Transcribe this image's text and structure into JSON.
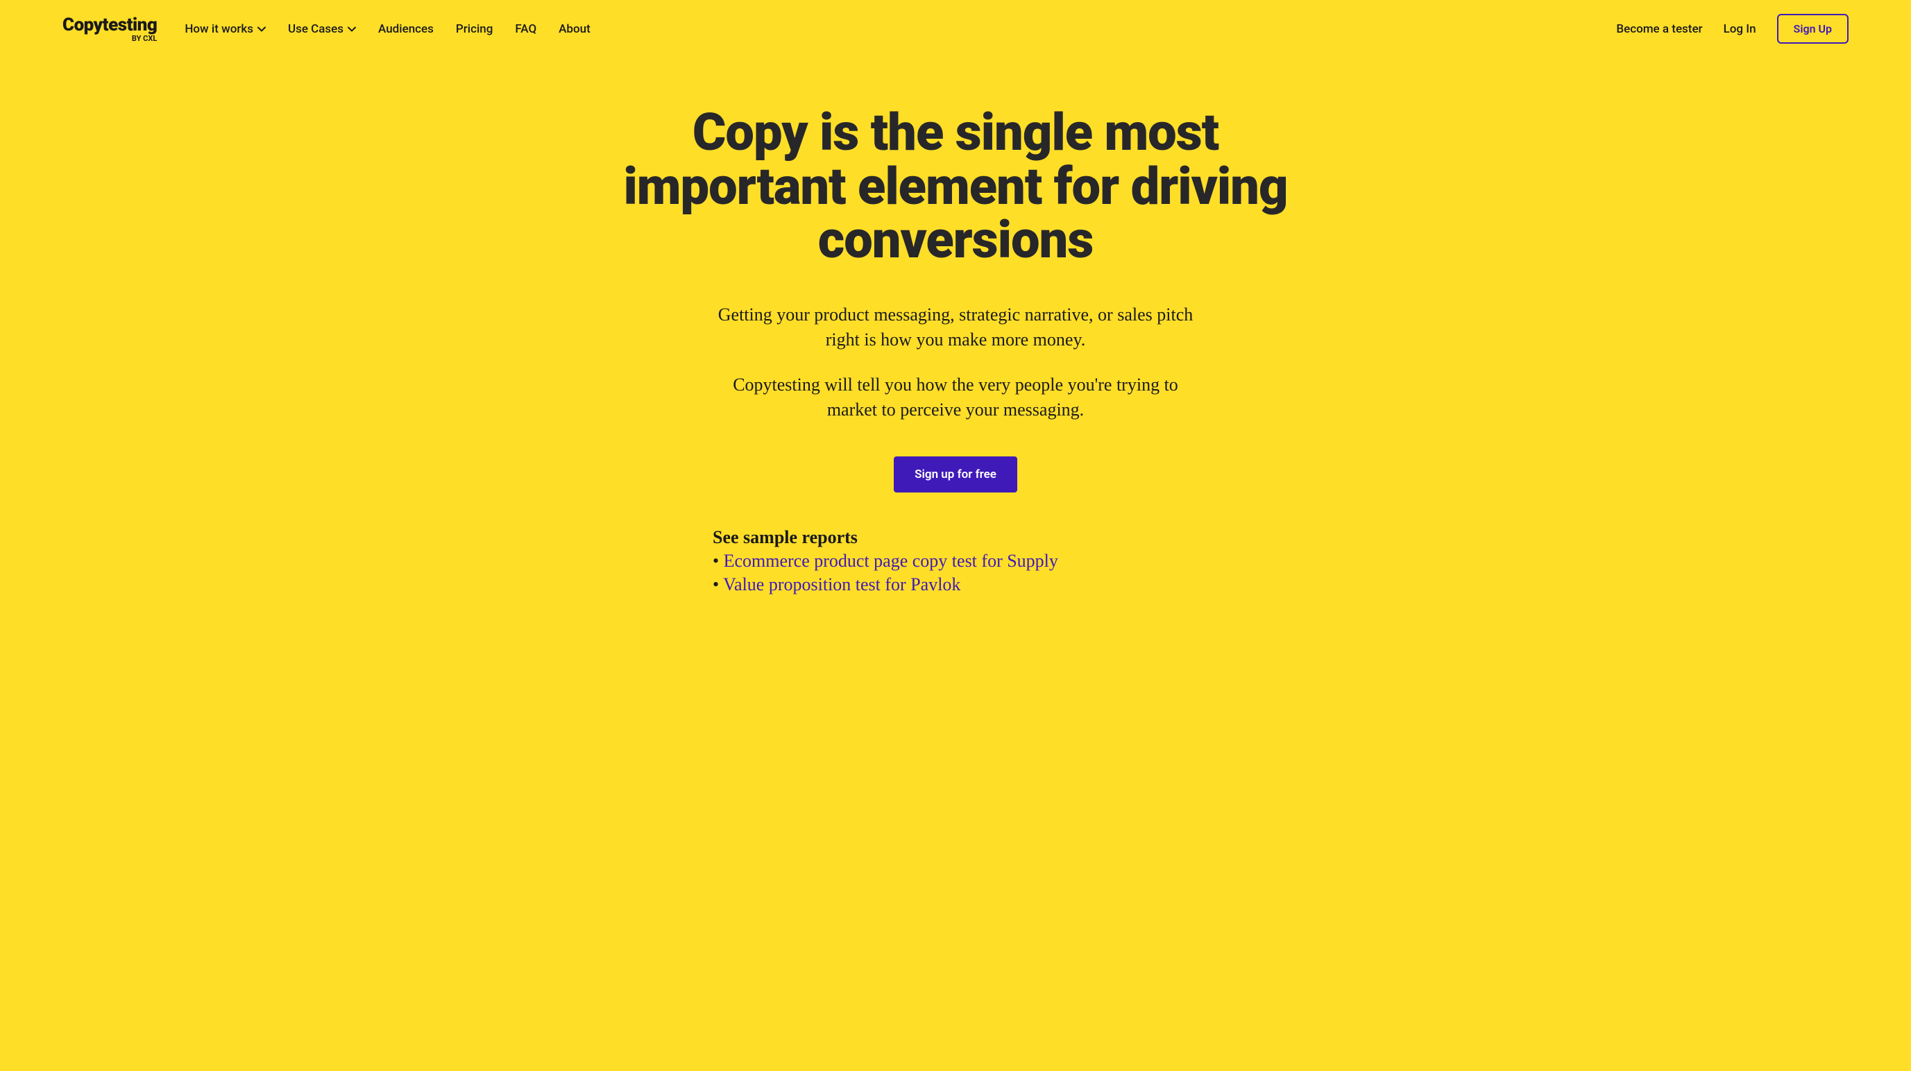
{
  "logo": {
    "main": "Copytesting",
    "sub": "BY CXL"
  },
  "nav": {
    "how_it_works": "How it works",
    "use_cases": "Use Cases",
    "audiences": "Audiences",
    "pricing": "Pricing",
    "faq": "FAQ",
    "about": "About"
  },
  "header_right": {
    "become_tester": "Become a tester",
    "log_in": "Log In",
    "sign_up": "Sign Up"
  },
  "hero": {
    "title": "Copy is the single most important element for driving conversions",
    "subtitle_1": "Getting your product messaging, strategic narrative, or sales pitch right is how you make more money.",
    "subtitle_2": "Copytesting will tell you how the very people you're trying to market to perceive your messaging.",
    "cta": "Sign up for free"
  },
  "sample_reports": {
    "heading": "See sample reports",
    "bullet": "•",
    "link_1": "Ecommerce product page copy test for Supply",
    "link_2": "Value proposition test for Pavlok"
  },
  "colors": {
    "background": "#FFDE28",
    "accent": "#3F1AB8",
    "text_dark": "#27272a"
  }
}
